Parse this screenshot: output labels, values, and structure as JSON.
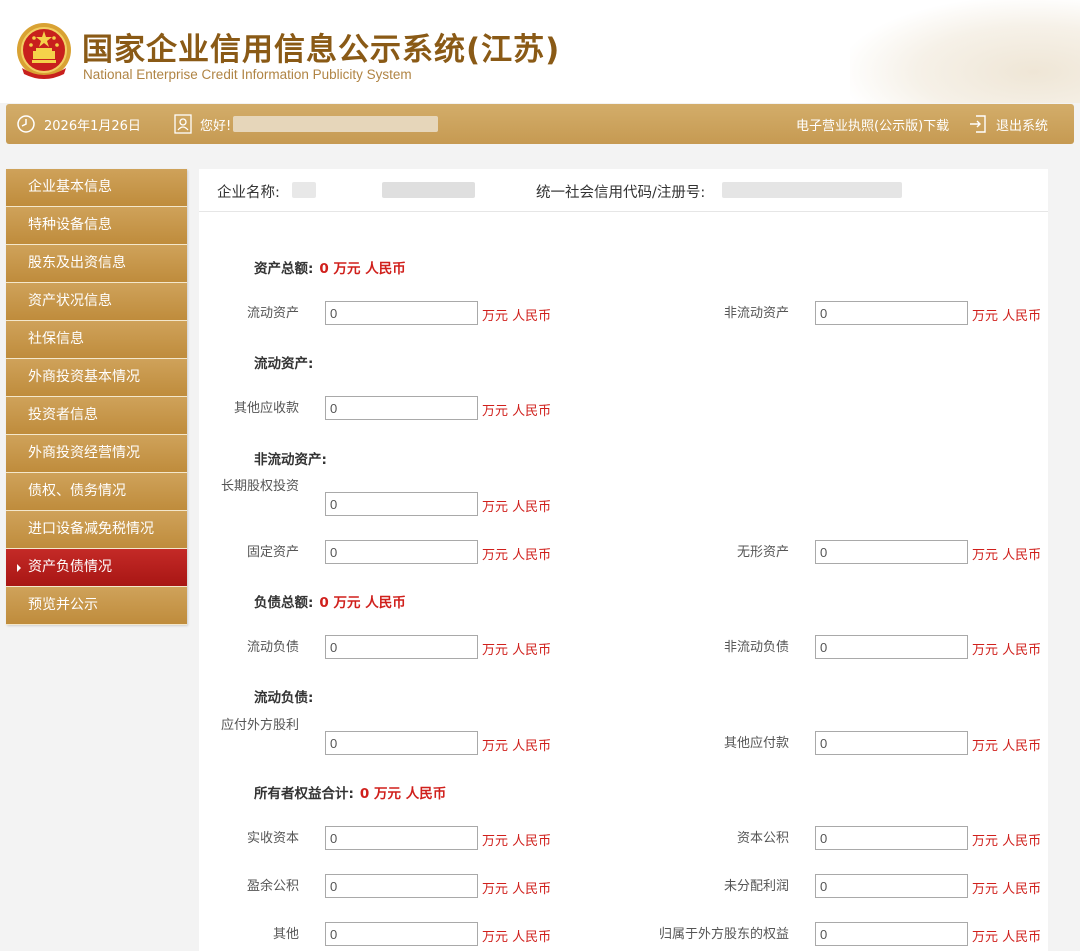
{
  "header": {
    "title_cn": "国家企业信用信息公示系统(江苏)",
    "title_en": "National Enterprise Credit Information Publicity System"
  },
  "topbar": {
    "date": "2026年1月26日",
    "greeting": "您好!",
    "license_download": "电子营业执照(公示版)下载",
    "logout": "退出系统"
  },
  "sidebar": {
    "items": [
      {
        "label": "企业基本信息"
      },
      {
        "label": "特种设备信息"
      },
      {
        "label": "股东及出资信息"
      },
      {
        "label": "资产状况信息"
      },
      {
        "label": "社保信息"
      },
      {
        "label": "外商投资基本情况"
      },
      {
        "label": "投资者信息"
      },
      {
        "label": "外商投资经营情况"
      },
      {
        "label": "债权、债务情况"
      },
      {
        "label": "进口设备减免税情况"
      },
      {
        "label": "资产负债情况"
      },
      {
        "label": "预览并公示"
      }
    ],
    "active_index": 10
  },
  "company": {
    "name_label": "企业名称:",
    "code_label": "统一社会信用代码/注册号:"
  },
  "unit": "万元 人民币",
  "sections": {
    "total_assets": {
      "label": "资产总额:",
      "value": "0 万元 人民币"
    },
    "current_assets": {
      "label": "流动资产:"
    },
    "noncurrent_assets": {
      "label": "非流动资产:"
    },
    "total_liabilities": {
      "label": "负债总额:",
      "value": "0 万元 人民币"
    },
    "current_liabilities": {
      "label": "流动负债:"
    },
    "owners_equity": {
      "label": "所有者权益合计:",
      "value": "0 万元 人民币"
    }
  },
  "fields": {
    "liudong_zichan": {
      "label": "流动资产",
      "value": "0"
    },
    "feiliudong_zichan": {
      "label": "非流动资产",
      "value": "0"
    },
    "qita_yingshou": {
      "label": "其他应收款",
      "value": "0"
    },
    "changqi_guquan": {
      "label": "长期股权投资",
      "value": "0"
    },
    "guding_zichan": {
      "label": "固定资产",
      "value": "0"
    },
    "wuxing_zichan": {
      "label": "无形资产",
      "value": "0"
    },
    "liudong_fuzhai": {
      "label": "流动负债",
      "value": "0"
    },
    "feiliudong_fuzhai": {
      "label": "非流动负债",
      "value": "0"
    },
    "yingfu_guli": {
      "label": "应付外方股利",
      "value": "0"
    },
    "qita_yingfu": {
      "label": "其他应付款",
      "value": "0"
    },
    "shishou_ziben": {
      "label": "实收资本",
      "value": "0"
    },
    "ziben_gongji": {
      "label": "资本公积",
      "value": "0"
    },
    "yingyu_gongji": {
      "label": "盈余公积",
      "value": "0"
    },
    "weifenpei_lirun": {
      "label": "未分配利润",
      "value": "0"
    },
    "qita": {
      "label": "其他",
      "value": "0"
    },
    "waifang_quanyi": {
      "label": "归属于外方股东的权益",
      "value": "0"
    }
  },
  "colors": {
    "gold": "#c69a52",
    "active_red": "#b81e1c",
    "accent_red": "#d0201c",
    "title_brown": "#8a5a16"
  }
}
